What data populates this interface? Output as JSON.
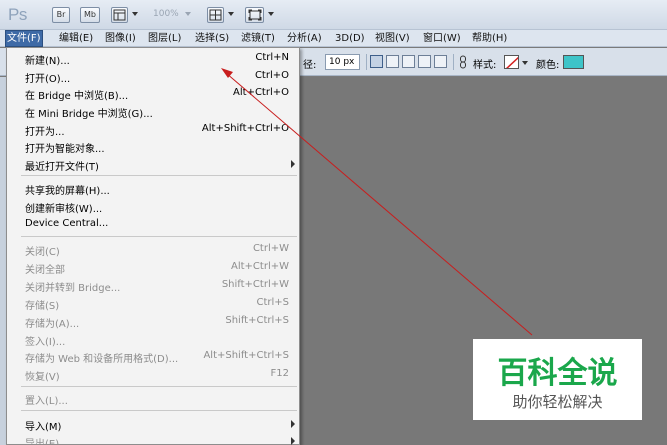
{
  "app": {
    "logo": "Ps",
    "toolbar": {
      "br_label": "Br",
      "mb_label": "Mb",
      "zoom": "100%"
    }
  },
  "menubar": {
    "items": [
      {
        "label": "文件(F)",
        "active": true
      },
      {
        "label": "编辑(E)"
      },
      {
        "label": "图像(I)"
      },
      {
        "label": "图层(L)"
      },
      {
        "label": "选择(S)"
      },
      {
        "label": "滤镜(T)"
      },
      {
        "label": "分析(A)"
      },
      {
        "label": "3D(D)"
      },
      {
        "label": "视图(V)"
      },
      {
        "label": "窗口(W)"
      },
      {
        "label": "帮助(H)"
      }
    ]
  },
  "options": {
    "radius_label": "径:",
    "radius_value": "10 px",
    "style_label": "样式:",
    "color_label": "颜色:",
    "color_value": "#3ec4c8"
  },
  "file_menu": {
    "items": [
      {
        "label": "新建(N)...",
        "shortcut": "Ctrl+N"
      },
      {
        "label": "打开(O)...",
        "shortcut": "Ctrl+O"
      },
      {
        "label": "在 Bridge 中浏览(B)...",
        "shortcut": "Alt+Ctrl+O"
      },
      {
        "label": "在 Mini Bridge 中浏览(G)...",
        "shortcut": ""
      },
      {
        "label": "打开为...",
        "shortcut": "Alt+Shift+Ctrl+O"
      },
      {
        "label": "打开为智能对象...",
        "shortcut": ""
      },
      {
        "label": "最近打开文件(T)",
        "shortcut": "",
        "submenu": true
      },
      {
        "label": "共享我的屏幕(H)...",
        "shortcut": ""
      },
      {
        "label": "创建新审核(W)...",
        "shortcut": ""
      },
      {
        "label": "Device Central...",
        "shortcut": ""
      },
      {
        "label": "关闭(C)",
        "shortcut": "Ctrl+W",
        "disabled": true
      },
      {
        "label": "关闭全部",
        "shortcut": "Alt+Ctrl+W",
        "disabled": true
      },
      {
        "label": "关闭并转到 Bridge...",
        "shortcut": "Shift+Ctrl+W",
        "disabled": true
      },
      {
        "label": "存储(S)",
        "shortcut": "Ctrl+S",
        "disabled": true
      },
      {
        "label": "存储为(A)...",
        "shortcut": "Shift+Ctrl+S",
        "disabled": true
      },
      {
        "label": "签入(I)...",
        "shortcut": "",
        "disabled": true
      },
      {
        "label": "存储为 Web 和设备所用格式(D)...",
        "shortcut": "Alt+Shift+Ctrl+S",
        "disabled": true
      },
      {
        "label": "恢复(V)",
        "shortcut": "F12",
        "disabled": true
      },
      {
        "label": "置入(L)...",
        "shortcut": "",
        "disabled": true
      },
      {
        "label": "导入(M)",
        "shortcut": "",
        "submenu": true
      },
      {
        "label": "导出(E)",
        "shortcut": "",
        "submenu": true,
        "disabled": true
      }
    ]
  },
  "watermark": {
    "title": "百科全说",
    "subtitle": "助你轻松解决"
  },
  "colors": {
    "annotation_arrow": "#c81e1e",
    "watermark_green": "#1aa74b",
    "menu_highlight": "#3e6aa6"
  }
}
